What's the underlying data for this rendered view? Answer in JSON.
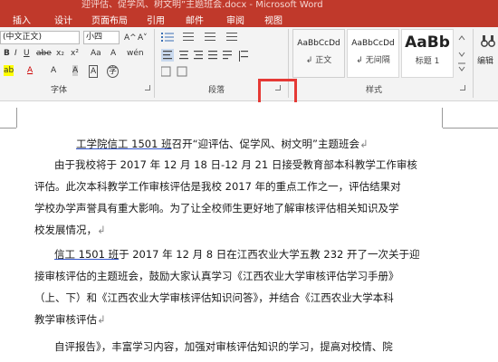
{
  "window": {
    "title": "迎评估、促学风、树文明”主题班会.docx - Microsoft Word"
  },
  "tabs": [
    "插入",
    "设计",
    "页面布局",
    "引用",
    "邮件",
    "审阅",
    "视图"
  ],
  "ribbon": {
    "font_name": "(中文正文)",
    "font_size": "小四",
    "font_group_label": "字体",
    "paragraph_group_label": "段落",
    "styles_group_label": "样式",
    "edit_label": "编辑",
    "styles": [
      {
        "preview": "AaBbCcDd",
        "name": "↲ 正文"
      },
      {
        "preview": "AaBbCcDd",
        "name": "↲ 无间隔"
      },
      {
        "preview": "AaBb",
        "name": "标题 1"
      }
    ],
    "grow_font": "A^",
    "shrink_font": "A˅",
    "change_case": "Aa",
    "clear_format": "A",
    "phonetic": "wén",
    "char_border": "A",
    "strike": "abe",
    "subscript": "x₂",
    "superscript": "x²",
    "text_effect": "A",
    "highlight": "ab",
    "font_color": "A",
    "char_shading": "A",
    "enclose": "字"
  },
  "document": {
    "title_prefix": "工学院信工 1501 班",
    "title_rest": "召开“迎评估、促学风、树文明”主题班会",
    "p1": [
      "由于我校将于 2017 年 12 月 18 日-12 月 21 日接受教育部本科教学工作审核",
      "评估。此次本科教学工作审核评估是我校 2017 年的重点工作之一，评估结果对",
      "学校办学声誉具有重大影响。为了让全校师生更好地了解审核评估相关知识及学",
      "校发展情况，"
    ],
    "p2_underlined": "信工 1501 班",
    "p2": [
      "于 2017 年 12 月 8 日在江西农业大学五教 232 开了一次关于迎",
      "接审核评估的主题班会，鼓励大家认真学习《江西农业大学审核评估学习手册》",
      "（上、下）和《江西农业大学审核评估知识问答》，并结合《江西农业大学本科",
      "教学审核评估"
    ],
    "p3": "自评报告》，丰富学习内容，加强对审核评估知识的学习，提高对校情、院",
    "para_mark": "↲"
  }
}
